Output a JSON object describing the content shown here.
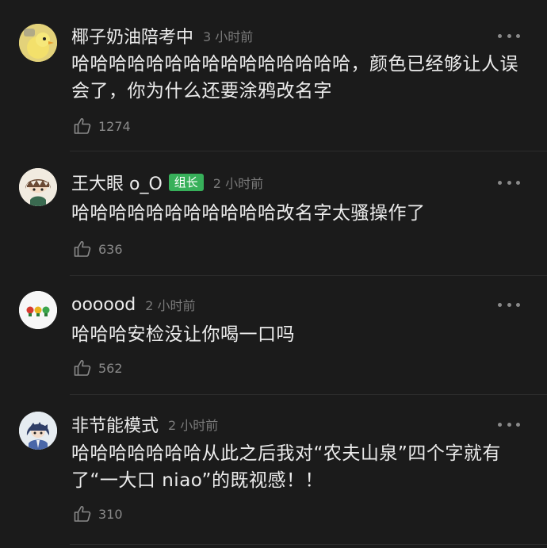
{
  "comments": [
    {
      "username": "椰子奶油陪考中",
      "badge": "",
      "time": "3 小时前",
      "text": "哈哈哈哈哈哈哈哈哈哈哈哈哈哈哈，颜色已经够让人误会了，你为什么还要涂鸦改名字",
      "likes": "1274",
      "avatar_icon": "duckling-avatar"
    },
    {
      "username": "王大眼 o_O",
      "badge": "组长",
      "time": "2 小时前",
      "text": "哈哈哈哈哈哈哈哈哈哈哈改名字太骚操作了",
      "likes": "636",
      "avatar_icon": "anime-boy-avatar"
    },
    {
      "username": "oooood",
      "badge": "",
      "time": "2 小时前",
      "text": "哈哈哈安检没让你喝一口吗",
      "likes": "562",
      "avatar_icon": "traffic-light-avatar"
    },
    {
      "username": "非节能模式",
      "badge": "",
      "time": "2 小时前",
      "text": "哈哈哈哈哈哈哈从此之后我对“农夫山泉”四个字就有了“一大口 niao”的既视感！！",
      "likes": "310",
      "avatar_icon": "anime-character-avatar"
    }
  ],
  "colors": {
    "background": "#1b1b1b",
    "badge": "#37b05a",
    "text": "#ececec",
    "muted": "#7a7a7a"
  }
}
